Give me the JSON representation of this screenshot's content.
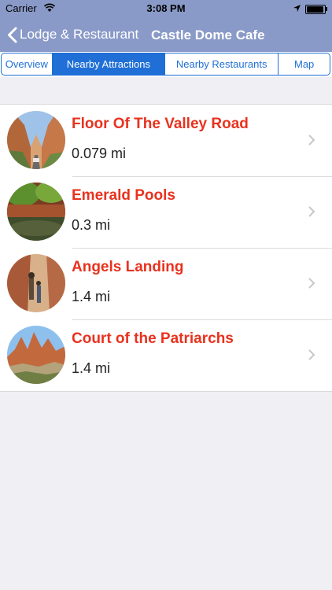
{
  "status_bar": {
    "carrier": "Carrier",
    "time": "3:08 PM"
  },
  "nav": {
    "back_label": "Lodge & Restaurant",
    "title": "Castle Dome Cafe"
  },
  "tabs": [
    {
      "label": "Overview",
      "active": false
    },
    {
      "label": "Nearby Attractions",
      "active": true
    },
    {
      "label": "Nearby Restaurants",
      "active": false
    },
    {
      "label": "Map",
      "active": false
    }
  ],
  "attractions": [
    {
      "name": "Floor Of The Valley Road",
      "distance": "0.079 mi",
      "image": "canyon-road-photo"
    },
    {
      "name": "Emerald Pools",
      "distance": "0.3 mi",
      "image": "emerald-pool-photo"
    },
    {
      "name": "Angels Landing",
      "distance": "1.4 mi",
      "image": "angels-landing-photo"
    },
    {
      "name": "Court of the Patriarchs",
      "distance": "1.4 mi",
      "image": "patriarchs-photo"
    }
  ],
  "colors": {
    "nav_bar": "#8a9ac8",
    "accent": "#1f6fd6",
    "title_red": "#e8321e",
    "background": "#efeff4"
  }
}
